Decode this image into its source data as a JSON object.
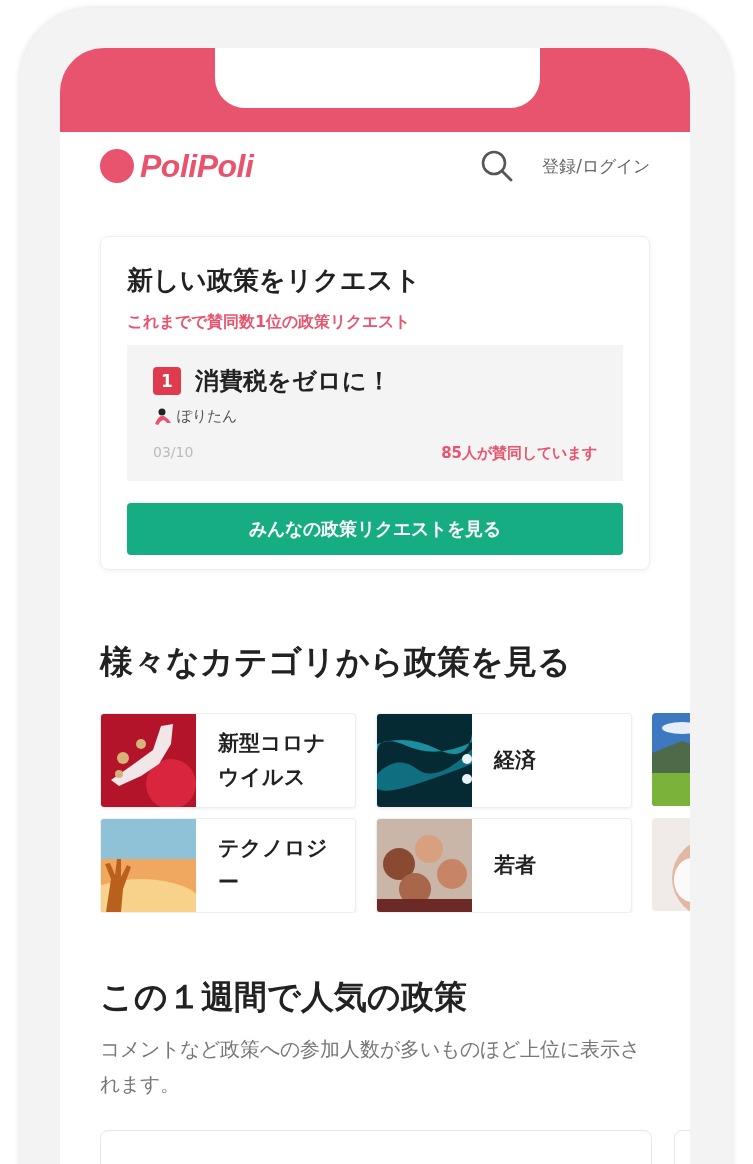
{
  "header": {
    "logo": "PoliPoli",
    "login": "登録/ログイン"
  },
  "request_card": {
    "title": "新しい政策をリクエスト",
    "subtitle": "これまでで賛同数1位の政策リクエスト",
    "top_request": {
      "rank": "1",
      "title": "消費税をゼロに！",
      "author": "ぽりたん",
      "date": "03/10",
      "supporters": "85人が賛同しています"
    },
    "button": "みんなの政策リクエストを見る"
  },
  "categories": {
    "title": "様々なカテゴリから政策を見る",
    "items": [
      {
        "label": "新型コロナウイルス",
        "kind": "tile"
      },
      {
        "label": "経済",
        "kind": "tile"
      },
      {
        "kind": "picture"
      },
      {
        "label": "テクノロジー",
        "kind": "tile"
      },
      {
        "label": "若者",
        "kind": "tile"
      },
      {
        "kind": "picture"
      }
    ]
  },
  "popular": {
    "title": "この１週間で人気の政策",
    "description": "コメントなど政策への参加人数が多いものほど上位に表示されます。"
  }
}
